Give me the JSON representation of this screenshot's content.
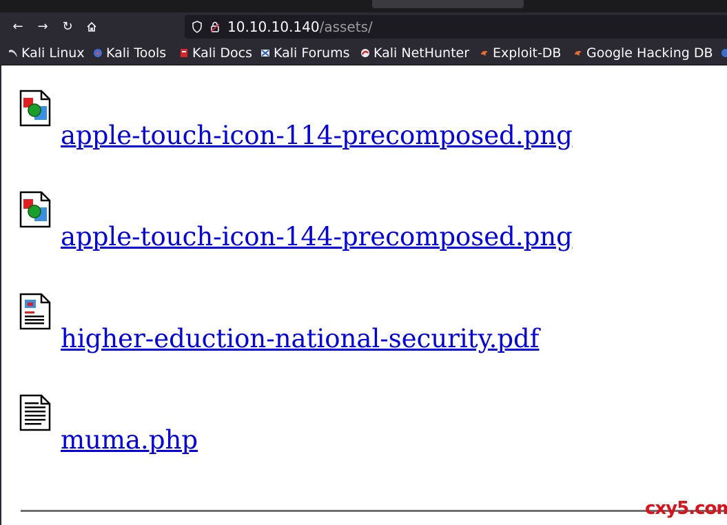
{
  "browser": {
    "url_host": "10.10.10.140",
    "url_path": "/assets/",
    "bookmarks": [
      {
        "label": "Kali Linux",
        "icon": "kali-dragon-icon"
      },
      {
        "label": "Kali Tools",
        "icon": "kali-tools-icon"
      },
      {
        "label": "Kali Docs",
        "icon": "kali-docs-icon"
      },
      {
        "label": "Kali Forums",
        "icon": "kali-forums-icon"
      },
      {
        "label": "Kali NetHunter",
        "icon": "kali-nethunter-icon"
      },
      {
        "label": "Exploit-DB",
        "icon": "exploit-db-icon"
      },
      {
        "label": "Google Hacking DB",
        "icon": "ghdb-icon"
      }
    ]
  },
  "listing": {
    "files": [
      {
        "name": "apple-touch-icon-114-precomposed.png",
        "icon": "image-file-icon"
      },
      {
        "name": "apple-touch-icon-144-precomposed.png",
        "icon": "image-file-icon"
      },
      {
        "name": "higher-eduction-national-security.pdf",
        "icon": "document-layout-icon"
      },
      {
        "name": "muma.php",
        "icon": "text-file-icon"
      }
    ]
  },
  "watermark": "cxy5.com"
}
